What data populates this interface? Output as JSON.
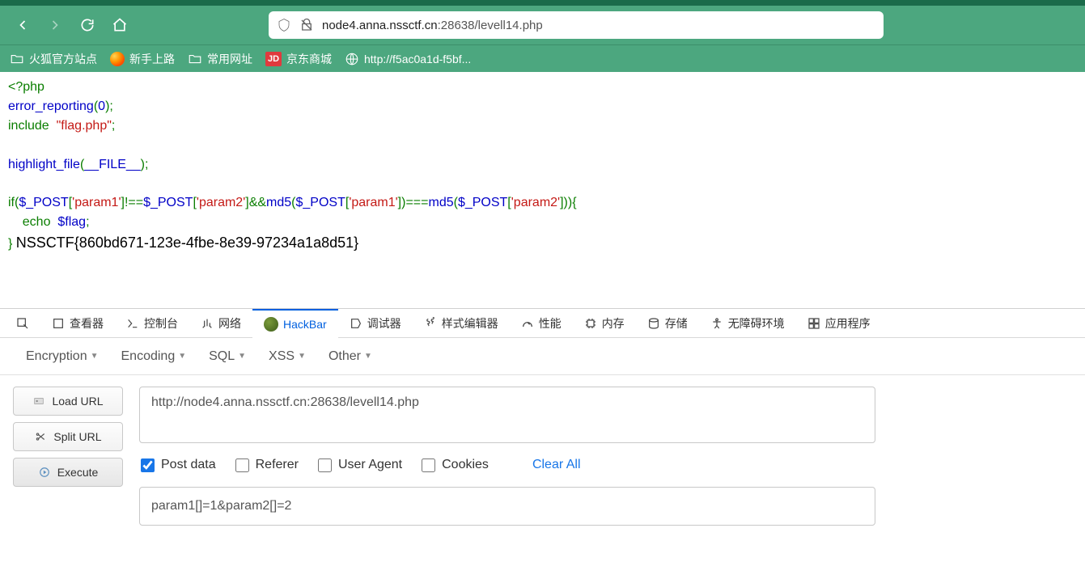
{
  "url": {
    "full": "node4.anna.nssctf.cn:28638/levell14.php",
    "host": "node4.anna.nssctf.cn",
    "rest": ":28638/levell14.php"
  },
  "bookmarks": [
    {
      "icon": "folder",
      "label": "火狐官方站点"
    },
    {
      "icon": "firefox",
      "label": "新手上路"
    },
    {
      "icon": "folder",
      "label": "常用网址"
    },
    {
      "icon": "jd",
      "label": "京东商城"
    },
    {
      "icon": "globe",
      "label": "http://f5ac0a1d-f5bf..."
    }
  ],
  "code": {
    "l1a": "<?php",
    "l2a": "error_reporting",
    "l2b": "(",
    "l2c": "0",
    "l2d": ");",
    "l3a": "include  ",
    "l3b": "\"flag.php\"",
    "l3c": ";",
    "l4a": "highlight_file",
    "l4b": "(",
    "l4c": "__FILE__",
    "l4d": ");",
    "l5a": "if(",
    "l5b": "$_POST",
    "l5c": "[",
    "l5d": "'param1'",
    "l5e": "]!==",
    "l5f": "$_POST",
    "l5g": "[",
    "l5h": "'param2'",
    "l5i": "]&&",
    "l5j": "md5",
    "l5k": "(",
    "l5l": "$_POST",
    "l5m": "[",
    "l5n": "'param1'",
    "l5o": "])===",
    "l5p": "md5",
    "l5q": "(",
    "l5r": "$_POST",
    "l5s": "[",
    "l5t": "'param2'",
    "l5u": "])){",
    "l6": "    echo  $flag;",
    "l6a": "    echo  ",
    "l6b": "$flag",
    "l6c": ";",
    "l7a": "} ",
    "flag": "NSSCTF{860bd671-123e-4fbe-8e39-97234a1a8d51}"
  },
  "devtools": {
    "tabs": [
      {
        "id": "inspector",
        "label": "查看器"
      },
      {
        "id": "console",
        "label": "控制台"
      },
      {
        "id": "network",
        "label": "网络"
      },
      {
        "id": "hackbar",
        "label": "HackBar"
      },
      {
        "id": "debugger",
        "label": "调试器"
      },
      {
        "id": "style",
        "label": "样式编辑器"
      },
      {
        "id": "perf",
        "label": "性能"
      },
      {
        "id": "memory",
        "label": "内存"
      },
      {
        "id": "storage",
        "label": "存储"
      },
      {
        "id": "a11y",
        "label": "无障碍环境"
      },
      {
        "id": "app",
        "label": "应用程序"
      }
    ],
    "active": "hackbar"
  },
  "hackbar": {
    "menus": [
      "Encryption",
      "Encoding",
      "SQL",
      "XSS",
      "Other"
    ],
    "buttons": {
      "load": "Load URL",
      "split": "Split URL",
      "exec": "Execute"
    },
    "url": "http://node4.anna.nssctf.cn:28638/levell14.php",
    "opts": {
      "post": "Post data",
      "referer": "Referer",
      "ua": "User Agent",
      "cookies": "Cookies",
      "clear": "Clear All"
    },
    "checked": {
      "post": true,
      "referer": false,
      "ua": false,
      "cookies": false
    },
    "postdata": "param1[]=1&param2[]=2"
  }
}
